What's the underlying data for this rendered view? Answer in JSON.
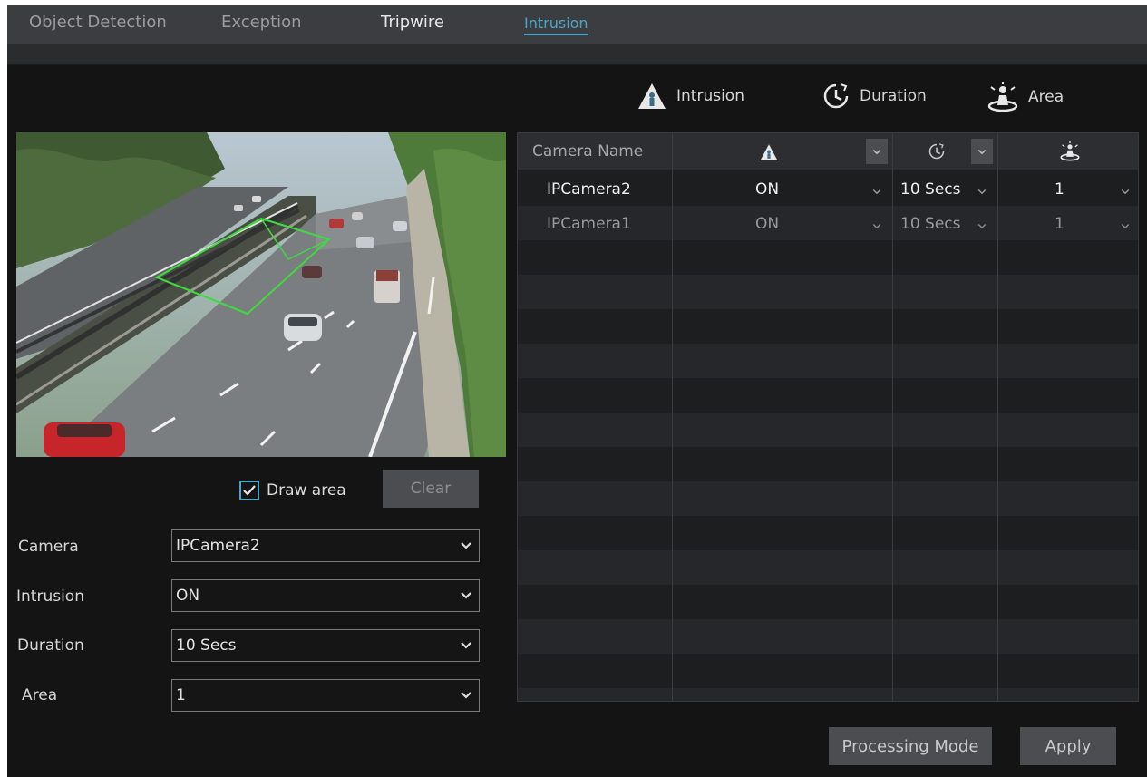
{
  "tabs": [
    {
      "label": "Object Detection"
    },
    {
      "label": "Exception"
    },
    {
      "label": "Tripwire"
    },
    {
      "label": "Intrusion"
    }
  ],
  "legend": {
    "intrusion": "Intrusion",
    "duration": "Duration",
    "area": "Area"
  },
  "draw_area": {
    "label": "Draw area",
    "checked": true
  },
  "clear_label": "Clear",
  "form": {
    "camera": {
      "label": "Camera",
      "value": "IPCamera2"
    },
    "intrusion": {
      "label": "Intrusion",
      "value": "ON"
    },
    "duration": {
      "label": "Duration",
      "value": "10 Secs"
    },
    "area": {
      "label": "Area",
      "value": "1"
    }
  },
  "table": {
    "header": {
      "camera_name": "Camera Name"
    },
    "rows": [
      {
        "camera": "IPCamera2",
        "intrusion": "ON",
        "duration": "10 Secs",
        "area": "1"
      },
      {
        "camera": "IPCamera1",
        "intrusion": "ON",
        "duration": "10 Secs",
        "area": "1"
      }
    ]
  },
  "buttons": {
    "processing_mode": "Processing Mode",
    "apply": "Apply"
  },
  "colors": {
    "accent": "#4aa6c8",
    "detection_area": "#3ddc3d"
  }
}
